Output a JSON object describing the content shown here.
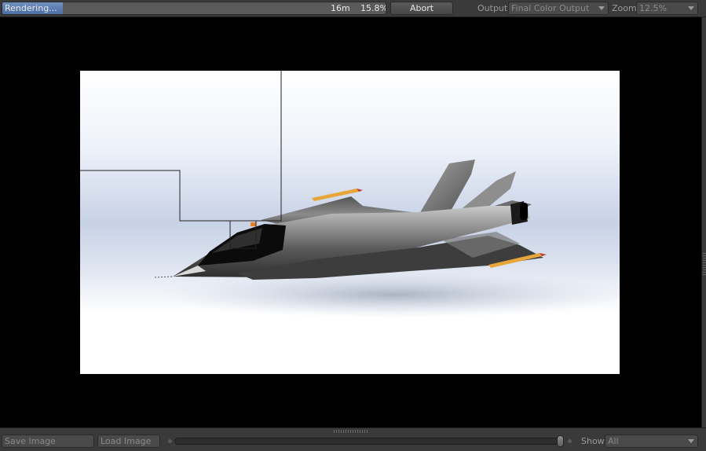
{
  "toolbar": {
    "status": "Rendering...",
    "elapsed": "16m",
    "progress_percent": "15.8%",
    "progress_fraction": 0.158,
    "abort_label": "Abort",
    "output_label": "Output",
    "output_value": "Final Color Output",
    "zoom_label": "Zoom",
    "zoom_value": "12.5%"
  },
  "bottom": {
    "save_label": "Save Image",
    "load_label": "Load Image",
    "show_label": "Show",
    "show_value": "All"
  },
  "colors": {
    "progress_fill": "#5b7db3",
    "background": "#000000",
    "panel": "#3a3a3a"
  },
  "icons": [
    "dropdown-arrow-icon",
    "grip-icon"
  ]
}
